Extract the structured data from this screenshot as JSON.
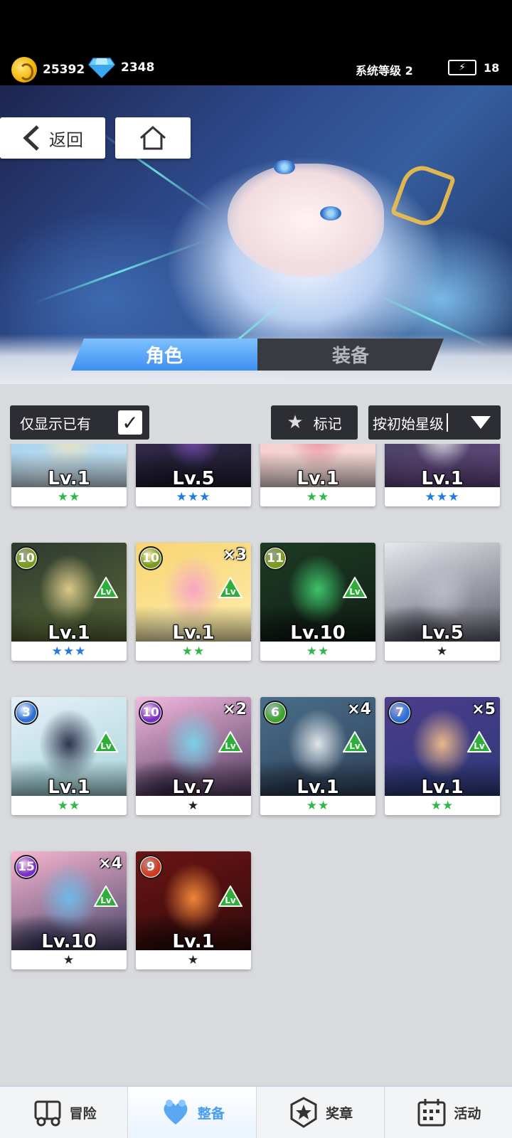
{
  "top": {
    "coins": "25392",
    "gems": "2348",
    "system_level": "系统等级 2",
    "energy": "18"
  },
  "nav": {
    "back_label": "返回"
  },
  "tabs": [
    {
      "label": "角色",
      "active": true
    },
    {
      "label": "装备",
      "active": false
    }
  ],
  "filters": {
    "owned_label": "仅显示已有",
    "owned_checked": "✓",
    "mark_label": "标记",
    "sort_label": "按初始星级"
  },
  "cards": [
    {
      "level": "Lv.1",
      "stars": "★★",
      "star_color": "#2fb84a",
      "rank": "",
      "count": "",
      "palette": [
        "#8fc7e8",
        "#f4e3b8",
        "#d9ecf7"
      ]
    },
    {
      "level": "Lv.5",
      "stars": "★★★",
      "star_color": "#1f7be0",
      "rank": "",
      "count": "",
      "palette": [
        "#3b2f56",
        "#7a4fb5",
        "#1c1c2e"
      ]
    },
    {
      "level": "Lv.1",
      "stars": "★★",
      "star_color": "#2fb84a",
      "rank": "",
      "count": "",
      "palette": [
        "#f2c4c9",
        "#e98f9b",
        "#fbe4e0"
      ]
    },
    {
      "level": "Lv.1",
      "stars": "★★★",
      "star_color": "#1f7be0",
      "rank": "",
      "count": "",
      "palette": [
        "#3a3d52",
        "#e6e7ee",
        "#6a4b88"
      ]
    },
    {
      "level": "Lv.1",
      "stars": "★★★",
      "star_color": "#1f7be0",
      "rank": "10",
      "rank_color": "#7a9b1e",
      "count": "",
      "palette": [
        "#2f3a2f",
        "#d9c98a",
        "#5d6e3a"
      ]
    },
    {
      "level": "Lv.1",
      "stars": "★★",
      "star_color": "#2fb84a",
      "rank": "10",
      "rank_color": "#7a9b1e",
      "count": "×3",
      "palette": [
        "#f7d470",
        "#f6a7c3",
        "#fff2b8"
      ]
    },
    {
      "level": "Lv.10",
      "stars": "★★",
      "star_color": "#2fb84a",
      "rank": "11",
      "rank_color": "#7a9b1e",
      "count": "",
      "palette": [
        "#1d3b25",
        "#3cc46a",
        "#0f1a12"
      ]
    },
    {
      "level": "Lv.5",
      "stars": "★",
      "star_color": "#222222",
      "rank": "",
      "count": "",
      "palette": [
        "#e7e8ee",
        "#b9bcc8",
        "#4a4a58"
      ]
    },
    {
      "level": "Lv.1",
      "stars": "★★",
      "star_color": "#2fb84a",
      "rank": "3",
      "rank_color": "#2c6fd6",
      "count": "",
      "palette": [
        "#e6f0f7",
        "#2e3550",
        "#9fd3d8"
      ]
    },
    {
      "level": "Lv.7",
      "stars": "★",
      "star_color": "#222222",
      "rank": "10",
      "rank_color": "#7a2fc6",
      "count": "×2",
      "palette": [
        "#f3b8e0",
        "#7bd0e8",
        "#3b2c4e"
      ]
    },
    {
      "level": "Lv.1",
      "stars": "★★",
      "star_color": "#2fb84a",
      "rank": "6",
      "rank_color": "#3fa52a",
      "count": "×4",
      "palette": [
        "#4a6e8a",
        "#dfe6ea",
        "#2b3b52"
      ]
    },
    {
      "level": "Lv.1",
      "stars": "★★",
      "star_color": "#2fb84a",
      "rank": "7",
      "rank_color": "#2c6fd6",
      "count": "×5",
      "palette": [
        "#4d3c8a",
        "#e9b88a",
        "#2a3a7a"
      ]
    },
    {
      "level": "Lv.10",
      "stars": "★",
      "star_color": "#222222",
      "rank": "15",
      "rank_color": "#7a2fc6",
      "count": "×4",
      "palette": [
        "#f7b6cf",
        "#6fb9e8",
        "#33365e"
      ]
    },
    {
      "level": "Lv.1",
      "stars": "★",
      "star_color": "#222222",
      "rank": "9",
      "rank_color": "#d23a1f",
      "count": "",
      "palette": [
        "#6b1414",
        "#f2863a",
        "#2a0a0a"
      ]
    }
  ],
  "bottom_nav": [
    {
      "label": "冒险",
      "icon": "truck-icon",
      "active": false
    },
    {
      "label": "整备",
      "icon": "heart-team-icon",
      "active": true
    },
    {
      "label": "奖章",
      "icon": "medal-icon",
      "active": false
    },
    {
      "label": "活动",
      "icon": "calendar-icon",
      "active": false
    }
  ]
}
